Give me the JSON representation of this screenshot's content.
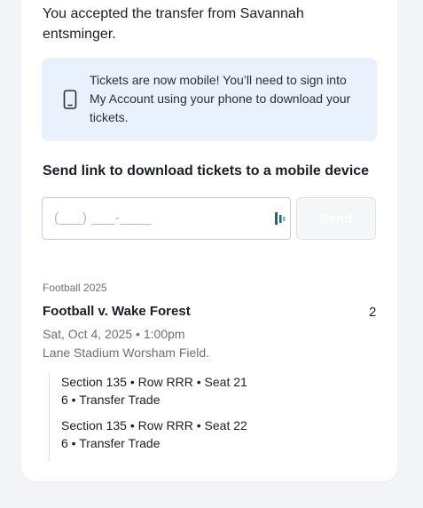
{
  "transfer": {
    "message": "You accepted the transfer from Savannah entsminger."
  },
  "info_banner": {
    "icon": "mobile-phone-icon",
    "text": "Tickets are now mobile! You’ll need to sign into My Account using your phone to download your tickets."
  },
  "send_link": {
    "heading": "Send link to download tickets to a mobile device",
    "phone_placeholder": "(___) ___-____",
    "field_icon": "password-manager-icon",
    "button_label": "Send"
  },
  "event": {
    "category": "Football 2025",
    "title": "Football v. Wake Forest",
    "ticket_count": "2",
    "date": "Sat, Oct 4, 2025 • 1:00pm",
    "venue": "Lane Stadium Worsham Field.",
    "tickets": [
      {
        "seat": "Section 135 • Row RRR • Seat 21",
        "detail": "6 • Transfer Trade"
      },
      {
        "seat": "Section 135 • Row RRR • Seat 22",
        "detail": "6 • Transfer Trade"
      }
    ]
  },
  "colors": {
    "banner_bg": "#e9f1fd",
    "page_bg": "#f2f4f7",
    "field_icon": "#2f5d7c"
  }
}
